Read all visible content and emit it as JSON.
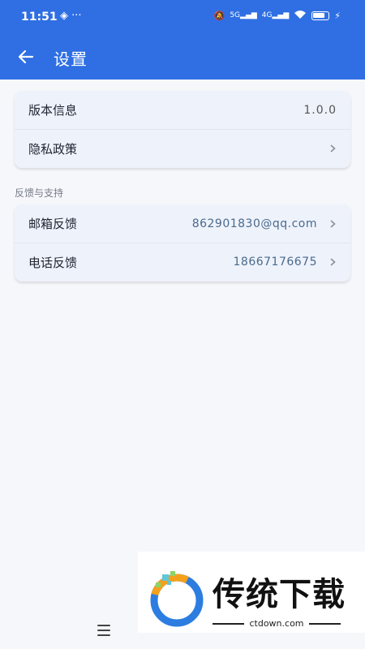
{
  "status": {
    "time": "11:51",
    "left_icons": [
      "nfc-icon",
      "more-icon"
    ],
    "net1": "5G",
    "net2": "4G"
  },
  "header": {
    "title": "设置"
  },
  "about": {
    "items": [
      {
        "label": "版本信息",
        "value": "1.0.0"
      },
      {
        "label": "隐私政策",
        "value": ""
      }
    ]
  },
  "feedback": {
    "section_title": "反馈与支持",
    "items": [
      {
        "label": "邮箱反馈",
        "value": "862901830@qq.com"
      },
      {
        "label": "电话反馈",
        "value": "18667176675"
      }
    ]
  },
  "watermark": {
    "title": "传统下载",
    "url": "ctdown.com"
  },
  "colors": {
    "primary": "#2f6fe3",
    "background": "#f6f7fb",
    "card": "#eef2fb"
  }
}
